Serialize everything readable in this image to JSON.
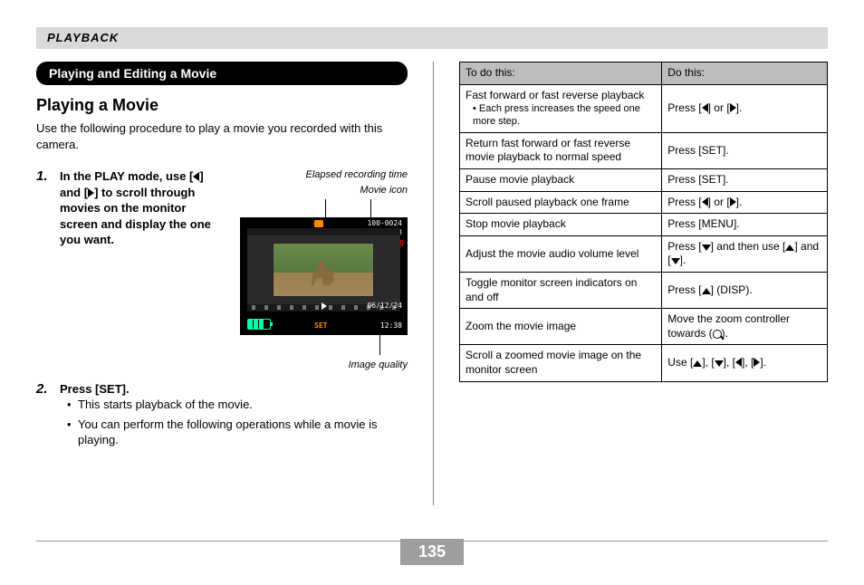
{
  "header": "PLAYBACK",
  "section_title": "Playing and Editing a Movie",
  "h2": "Playing a Movie",
  "intro": "Use the following procedure to play a movie you recorded with this camera.",
  "step1": {
    "num": "1.",
    "text_parts": [
      "In the PLAY mode, use [",
      "] and [",
      "] to scroll through movies on the monitor screen and display the one you want."
    ]
  },
  "callouts": {
    "elapsed": "Elapsed recording time",
    "movie_icon": "Movie icon",
    "image_quality": "Image quality"
  },
  "lcd": {
    "file_num": "100-0024",
    "elapsed": "00:08:23",
    "quality": "HQ",
    "date": "06/12/24",
    "time": "12:38",
    "set": "SET"
  },
  "step2": {
    "num": "2.",
    "title": "Press [SET].",
    "bullets": [
      "This starts playback of the movie.",
      "You can perform the following operations while a movie is playing."
    ]
  },
  "table": {
    "head": [
      "To do this:",
      "Do this:"
    ],
    "rows": [
      {
        "todo": "Fast forward or fast reverse playback",
        "sub": "Each press increases the speed one more step.",
        "do_parts": [
          "Press [",
          "tri-l",
          "] or [",
          "tri-r",
          "]."
        ]
      },
      {
        "todo": "Return fast forward or fast reverse movie playback to normal speed",
        "do_text": "Press [SET]."
      },
      {
        "todo": "Pause movie playback",
        "do_text": "Press [SET]."
      },
      {
        "todo": "Scroll paused playback one frame",
        "do_parts": [
          "Press [",
          "tri-l",
          "] or [",
          "tri-r",
          "]."
        ]
      },
      {
        "todo": "Stop movie playback",
        "do_text": "Press [MENU]."
      },
      {
        "todo": "Adjust the movie audio volume level",
        "do_parts": [
          "Press [",
          "tri-d",
          "] and then use [",
          "tri-u",
          "] and [",
          "tri-d",
          "]."
        ]
      },
      {
        "todo": "Toggle monitor screen indicators on and off",
        "do_parts": [
          "Press [",
          "tri-u",
          "] (DISP)."
        ]
      },
      {
        "todo": "Zoom the movie image",
        "do_parts": [
          "Move the zoom controller towards (",
          "mag",
          ")."
        ]
      },
      {
        "todo": "Scroll a zoomed movie image on the monitor screen",
        "do_parts": [
          "Use [",
          "tri-u",
          "], [",
          "tri-d",
          "], [",
          "tri-l",
          "], [",
          "tri-r",
          "]."
        ]
      }
    ]
  },
  "page_number": "135"
}
